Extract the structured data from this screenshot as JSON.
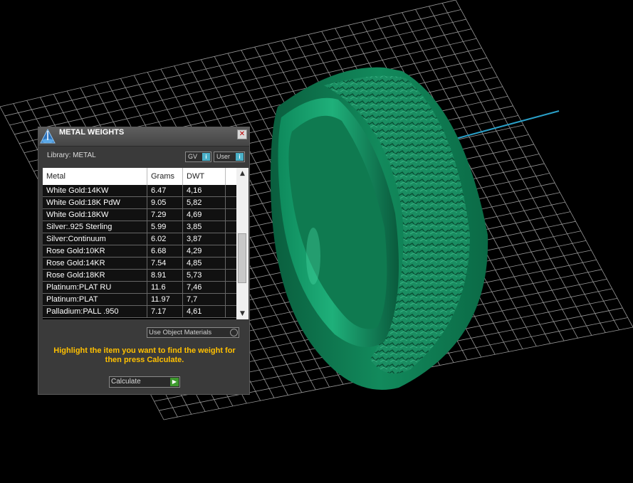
{
  "panel": {
    "title": "METAL WEIGHTS",
    "close_label": "✕",
    "library_label": "Library: METAL",
    "gv_label": "GV",
    "user_label": "User",
    "info_glyph": "i",
    "columns": [
      "Metal",
      "Grams",
      "DWT"
    ],
    "rows": [
      {
        "metal": "White Gold:14KW",
        "grams": "6.47",
        "dwt": "4,16"
      },
      {
        "metal": "White Gold:18K PdW",
        "grams": "9.05",
        "dwt": "5,82"
      },
      {
        "metal": "White Gold:18KW",
        "grams": "7.29",
        "dwt": "4,69"
      },
      {
        "metal": "Silver:.925 Sterling",
        "grams": "5.99",
        "dwt": "3,85"
      },
      {
        "metal": "Silver:Continuum",
        "grams": "6.02",
        "dwt": "3,87"
      },
      {
        "metal": "Rose Gold:10KR",
        "grams": "6.68",
        "dwt": "4,29"
      },
      {
        "metal": "Rose Gold:14KR",
        "grams": "7.54",
        "dwt": "4,85"
      },
      {
        "metal": "Rose Gold:18KR",
        "grams": "8.91",
        "dwt": "5,73"
      },
      {
        "metal": "Platinum:PLAT RU",
        "grams": "11.6",
        "dwt": "7,46"
      },
      {
        "metal": "Platinum:PLAT",
        "grams": "11.97",
        "dwt": "7,7"
      },
      {
        "metal": "Palladium:PALL .950",
        "grams": "7.17",
        "dwt": "4,61"
      }
    ],
    "scroll_up_glyph": "▲",
    "scroll_down_glyph": "▼",
    "use_object_materials_label": "Use Object Materials",
    "hint_text": "Highlight the item you want to find the weight for then press Calculate.",
    "calculate_label": "Calculate",
    "calculate_glyph": "▶"
  },
  "colors": {
    "ring_green": "#0d7a52",
    "grid": "#c8c8c8",
    "hint": "#ffc000",
    "axis_blue": "#2aa0c8",
    "axis_red": "#c82020"
  },
  "icons": {
    "title_icon": "metal-weights-app-icon",
    "close_icon": "close-icon",
    "info_icon": "info-icon",
    "calculate_icon": "play-arrow-icon"
  }
}
